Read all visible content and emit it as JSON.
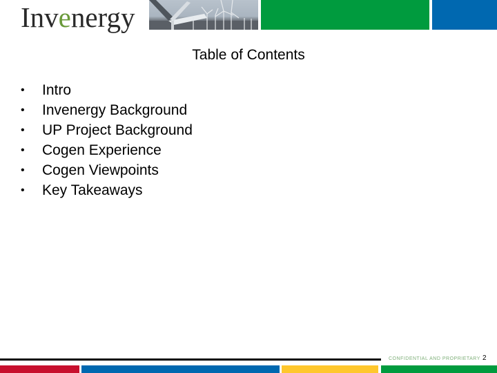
{
  "header": {
    "logo_prefix": "Inv",
    "logo_accent": "e",
    "logo_suffix": "nergy",
    "photo_label": "wind-turbines-photo",
    "colors": {
      "green": "#009b3e",
      "blue": "#0068b0",
      "logo_accent": "#6a9a3a"
    }
  },
  "slide": {
    "title": "Table of Contents",
    "bullet": "•",
    "items": [
      {
        "label": "Intro"
      },
      {
        "label": "Invenergy Background"
      },
      {
        "label": "UP Project Background"
      },
      {
        "label": "Cogen Experience"
      },
      {
        "label": "Cogen Viewpoints"
      },
      {
        "label": "Key Takeaways"
      }
    ]
  },
  "footer": {
    "confidential": "CONFIDENTIAL AND PROPRIETARY",
    "page_number": "2",
    "colors": {
      "red": "#c8102e",
      "blue": "#0068b0",
      "yellow": "#ffc72c",
      "green": "#009b3e"
    }
  }
}
